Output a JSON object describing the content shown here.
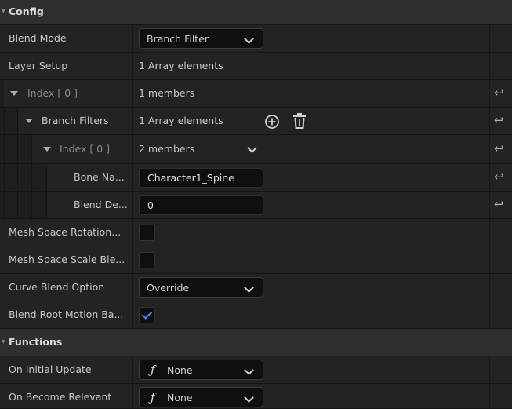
{
  "config": {
    "title": "Config",
    "blend_mode": {
      "label": "Blend Mode",
      "value": "Branch Filter"
    },
    "layer_setup": {
      "label": "Layer Setup",
      "value": "1 Array elements"
    },
    "index0": {
      "label": "Index [ 0 ]",
      "value": "1 members"
    },
    "branch_filters": {
      "label": "Branch Filters",
      "value": "1 Array elements"
    },
    "index0_inner": {
      "label": "Index [ 0 ]",
      "value": "2 members"
    },
    "bone_name": {
      "label": "Bone Na...",
      "value": "Character1_Spine"
    },
    "blend_depth": {
      "label": "Blend De...",
      "value": "0"
    },
    "mesh_space_rotation": {
      "label": "Mesh Space Rotation...",
      "checked": false
    },
    "mesh_space_scale": {
      "label": "Mesh Space Scale Ble...",
      "checked": false
    },
    "curve_blend_option": {
      "label": "Curve Blend Option",
      "value": "Override"
    },
    "blend_root_motion": {
      "label": "Blend Root Motion Ba...",
      "checked": true
    }
  },
  "functions": {
    "title": "Functions",
    "on_initial_update": {
      "label": "On Initial Update",
      "value": "None",
      "icon": "function-icon"
    },
    "on_become_relevant": {
      "label": "On Become Relevant",
      "value": "None",
      "icon": "function-icon"
    }
  },
  "icons": {
    "reset": "reset-arrow-icon",
    "add": "add-circle-icon",
    "delete": "trash-icon"
  },
  "colors": {
    "accent_check": "#3a8df0",
    "background": "#232323",
    "section": "#2f2f2f"
  }
}
